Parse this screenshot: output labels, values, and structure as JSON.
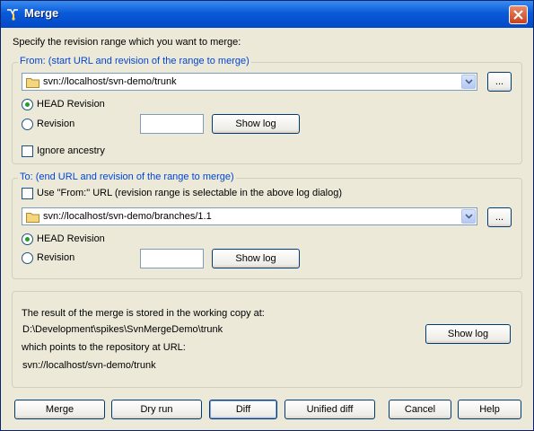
{
  "window": {
    "title": "Merge"
  },
  "instruction": "Specify the revision range which you want to merge:",
  "from": {
    "legend": "From: (start URL and revision of the range to merge)",
    "url": "svn://localhost/svn-demo/trunk",
    "browse_label": "...",
    "head_revision_label": "HEAD Revision",
    "revision_label": "Revision",
    "revision_value": "",
    "show_log_label": "Show log",
    "ignore_ancestry_label": "Ignore ancestry",
    "head_selected": true,
    "ignore_ancestry_checked": false
  },
  "to": {
    "legend": "To: (end URL and revision of the range to merge)",
    "use_from_label": "Use \"From:\" URL (revision range is selectable in the above log dialog)",
    "use_from_checked": false,
    "url": "svn://localhost/svn-demo/branches/1.1",
    "browse_label": "...",
    "head_revision_label": "HEAD Revision",
    "revision_label": "Revision",
    "revision_value": "",
    "show_log_label": "Show log",
    "head_selected": true
  },
  "result": {
    "stored_text": "The result of the merge is stored in the working copy at:",
    "working_copy_path": "D:\\Development\\spikes\\SvnMergeDemo\\trunk",
    "points_text": "which points to the repository at URL:",
    "repository_url": "svn://localhost/svn-demo/trunk",
    "show_log_label": "Show log"
  },
  "buttons": {
    "merge": "Merge",
    "dry_run": "Dry run",
    "diff": "Diff",
    "unified_diff": "Unified diff",
    "cancel": "Cancel",
    "help": "Help"
  },
  "colors": {
    "title_bar": "#0a5ad8",
    "legend_text": "#0046d5",
    "dialog_bg": "#ece9d8",
    "radio_dot": "#21a121"
  },
  "icons": {
    "title": "merge-app-icon",
    "close": "close-icon",
    "folder": "folder-icon",
    "dropdown": "chevron-down-icon"
  }
}
